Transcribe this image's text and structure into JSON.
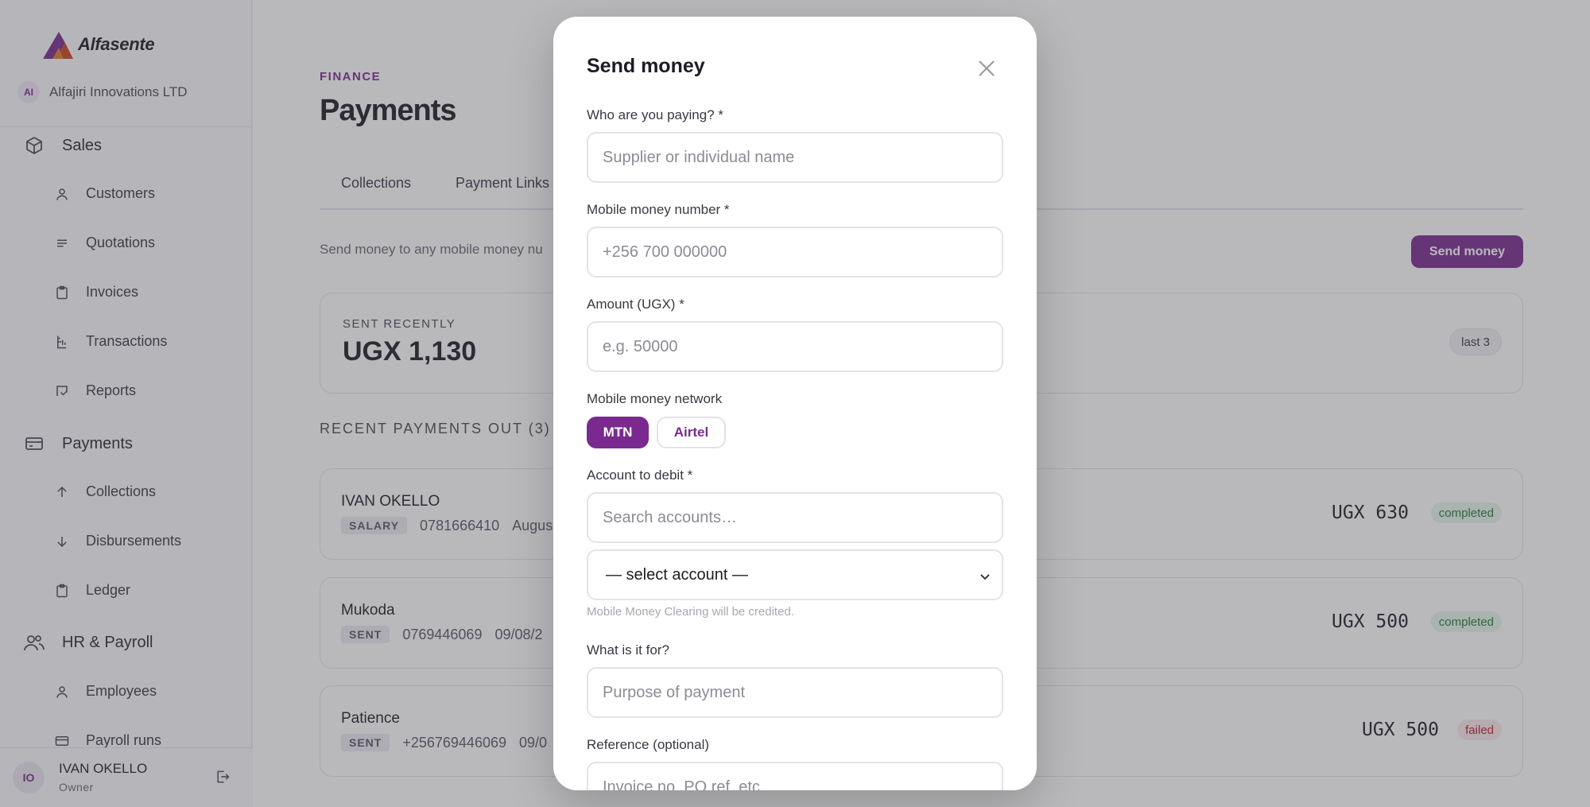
{
  "brand": {
    "name": "Alfasente"
  },
  "org": {
    "initials": "AI",
    "name": "Alfajiri Innovations LTD"
  },
  "sidebar": {
    "groups": [
      {
        "label": "Sales",
        "icon": "box-icon"
      },
      {
        "label": "Payments",
        "icon": "card-icon"
      },
      {
        "label": "HR & Payroll",
        "icon": "users-icon"
      }
    ],
    "items": [
      {
        "label": "Customers",
        "icon": "user-icon"
      },
      {
        "label": "Quotations",
        "icon": "lines-icon"
      },
      {
        "label": "Invoices",
        "icon": "clipboard-icon"
      },
      {
        "label": "Transactions",
        "icon": "receipt-icon"
      },
      {
        "label": "Reports",
        "icon": "report-icon"
      },
      {
        "label": "Collections",
        "icon": "arrow-up-icon"
      },
      {
        "label": "Disbursements",
        "icon": "arrow-down-icon"
      },
      {
        "label": "Ledger",
        "icon": "clipboard-icon"
      },
      {
        "label": "Employees",
        "icon": "user-icon"
      },
      {
        "label": "Payroll runs",
        "icon": "card-icon"
      }
    ]
  },
  "user": {
    "initials": "IO",
    "name": "IVAN OKELLO",
    "role": "Owner"
  },
  "header": {
    "eyebrow": "FINANCE",
    "title": "Payments"
  },
  "tabs": [
    {
      "label": "Collections"
    },
    {
      "label": "Payment Links"
    }
  ],
  "subtitle": "Send money to any mobile money nu",
  "send_button": "Send money",
  "summary": {
    "label": "SENT RECENTLY",
    "amount": "UGX 1,130",
    "badge": "last 3"
  },
  "recent": {
    "heading": "RECENT PAYMENTS OUT (3)",
    "rows": [
      {
        "name": "IVAN OKELLO",
        "tag": "SALARY",
        "phone": "0781666410",
        "date": "Augus",
        "amount": "UGX 630",
        "status": "completed"
      },
      {
        "name": "Mukoda",
        "tag": "SENT",
        "phone": "0769446069",
        "date": "09/08/2",
        "amount": "UGX 500",
        "status": "completed"
      },
      {
        "name": "Patience",
        "tag": "SENT",
        "phone": "+256769446069",
        "date": "09/0",
        "amount": "UGX 500",
        "status": "failed"
      }
    ]
  },
  "modal": {
    "title": "Send money",
    "payee_label": "Who are you paying? *",
    "payee_placeholder": "Supplier or individual name",
    "mobile_label": "Mobile money number *",
    "mobile_placeholder": "+256 700 000000",
    "amount_label": "Amount (UGX) *",
    "amount_placeholder": "e.g. 50000",
    "network_label": "Mobile money network",
    "networks": [
      {
        "label": "MTN",
        "selected": true
      },
      {
        "label": "Airtel",
        "selected": false
      }
    ],
    "account_label": "Account to debit *",
    "account_search_placeholder": "Search accounts…",
    "account_select_value": "— select account —",
    "account_hint": "Mobile Money Clearing will be credited.",
    "purpose_label": "What is it for?",
    "purpose_placeholder": "Purpose of payment",
    "reference_label": "Reference (optional)",
    "reference_placeholder": "Invoice no, PO ref, etc."
  },
  "colors": {
    "accent": "#7a2a8f",
    "success": "#237a3b",
    "danger": "#b42330"
  }
}
